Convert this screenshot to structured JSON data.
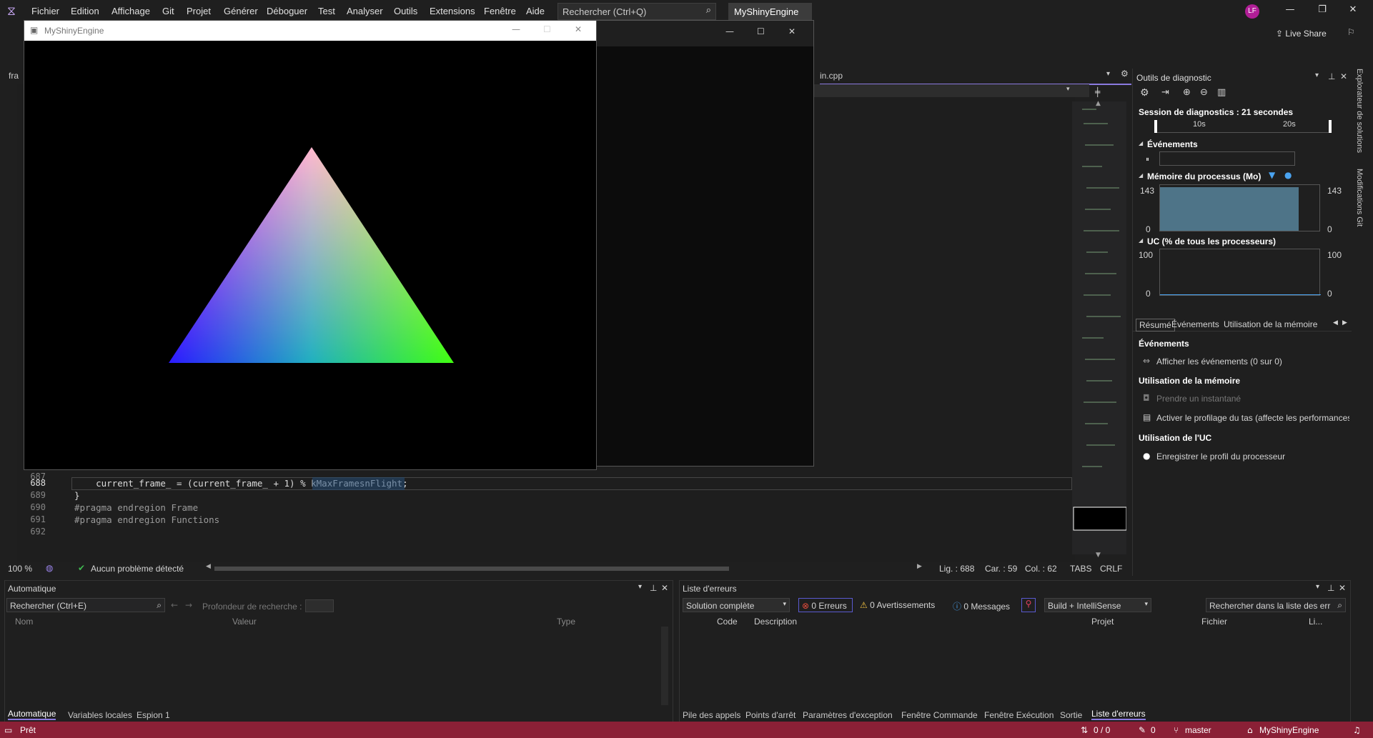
{
  "menu": [
    "Fichier",
    "Edition",
    "Affichage",
    "Git",
    "Projet",
    "Générer",
    "Déboguer",
    "Test",
    "Analyser",
    "Outils",
    "Extensions",
    "Fenêtre",
    "Aide"
  ],
  "search": {
    "placeholder": "Rechercher (Ctrl+Q)"
  },
  "solution_name": "MyShinyEngine",
  "avatar_initials": "LF",
  "live_share": "Live Share",
  "engine_window": {
    "title": "MyShinyEngine"
  },
  "editor": {
    "tab_left": "fra",
    "tab_right": "in.cpp",
    "lines": [
      {
        "num": "687",
        "code": ""
      },
      {
        "num": "688",
        "code": "    current_frame_ = (current_frame_ + 1) % kMaxFramesnFlight;"
      },
      {
        "num": "689",
        "code": "}"
      },
      {
        "num": "690",
        "code": "#pragma endregion Frame"
      },
      {
        "num": "691",
        "code": "#pragma endregion Functions"
      },
      {
        "num": "692",
        "code": ""
      }
    ],
    "zoom": "100 %",
    "issues": "Aucun problème détecté",
    "line": "Lig. : 688",
    "char": "Car. : 59",
    "col": "Col. : 62",
    "tabs": "TABS",
    "eol": "CRLF"
  },
  "diagnostics": {
    "title": "Outils de diagnostic",
    "session": "Session de diagnostics : 21 secondes",
    "tick1": "10s",
    "tick2": "20s",
    "events_label": "Événements",
    "memory_label": "Mémoire du processus (Mo)",
    "mem_max_left": "143",
    "mem_min_left": "0",
    "mem_max_right": "143",
    "mem_min_right": "0",
    "mem_level": 0.95,
    "cpu_label": "UC (% de tous les processeurs)",
    "cpu_max_left": "100",
    "cpu_min_left": "0",
    "cpu_max_right": "100",
    "cpu_min_right": "0",
    "tabs": [
      "Résumé",
      "Événements",
      "Utilisation de la mémoire"
    ],
    "sec_events": "Événements",
    "show_events": "Afficher les événements (0 sur 0)",
    "sec_memory": "Utilisation de la mémoire",
    "snapshot": "Prendre un instantané",
    "heap": "Activer le profilage du tas (affecte les performances)",
    "sec_cpu": "Utilisation de l'UC",
    "cpu_profile": "Enregistrer le profil du processeur"
  },
  "auto_panel": {
    "title": "Automatique",
    "search": "Rechercher (Ctrl+E)",
    "depth": "Profondeur de recherche :",
    "col_name": "Nom",
    "col_value": "Valeur",
    "col_type": "Type",
    "tabs": [
      "Automatique",
      "Variables locales",
      "Espion 1"
    ]
  },
  "err_panel": {
    "title": "Liste d'erreurs",
    "scope": "Solution complète",
    "errors": "0 Erreurs",
    "warnings": "0 Avertissements",
    "messages": "0 Messages",
    "build": "Build + IntelliSense",
    "search": "Rechercher dans la liste des err",
    "col_code": "Code",
    "col_desc": "Description",
    "col_project": "Projet",
    "col_file": "Fichier",
    "col_line": "Li...",
    "tabs": [
      "Pile des appels",
      "Points d'arrêt",
      "Paramètres d'exception",
      "Fenêtre Commande",
      "Fenêtre Exécution",
      "Sortie",
      "Liste d'erreurs"
    ]
  },
  "side_tabs": [
    "Explorateur de solutions",
    "Modifications Git"
  ],
  "status": {
    "ready": "Prêt",
    "updown": "0 / 0",
    "pencil": "0",
    "branch": "master",
    "repo": "MyShinyEngine"
  },
  "colors": {
    "accent": "#8a2036",
    "selection": "#264f78",
    "keyword": "#9b9b9b"
  }
}
